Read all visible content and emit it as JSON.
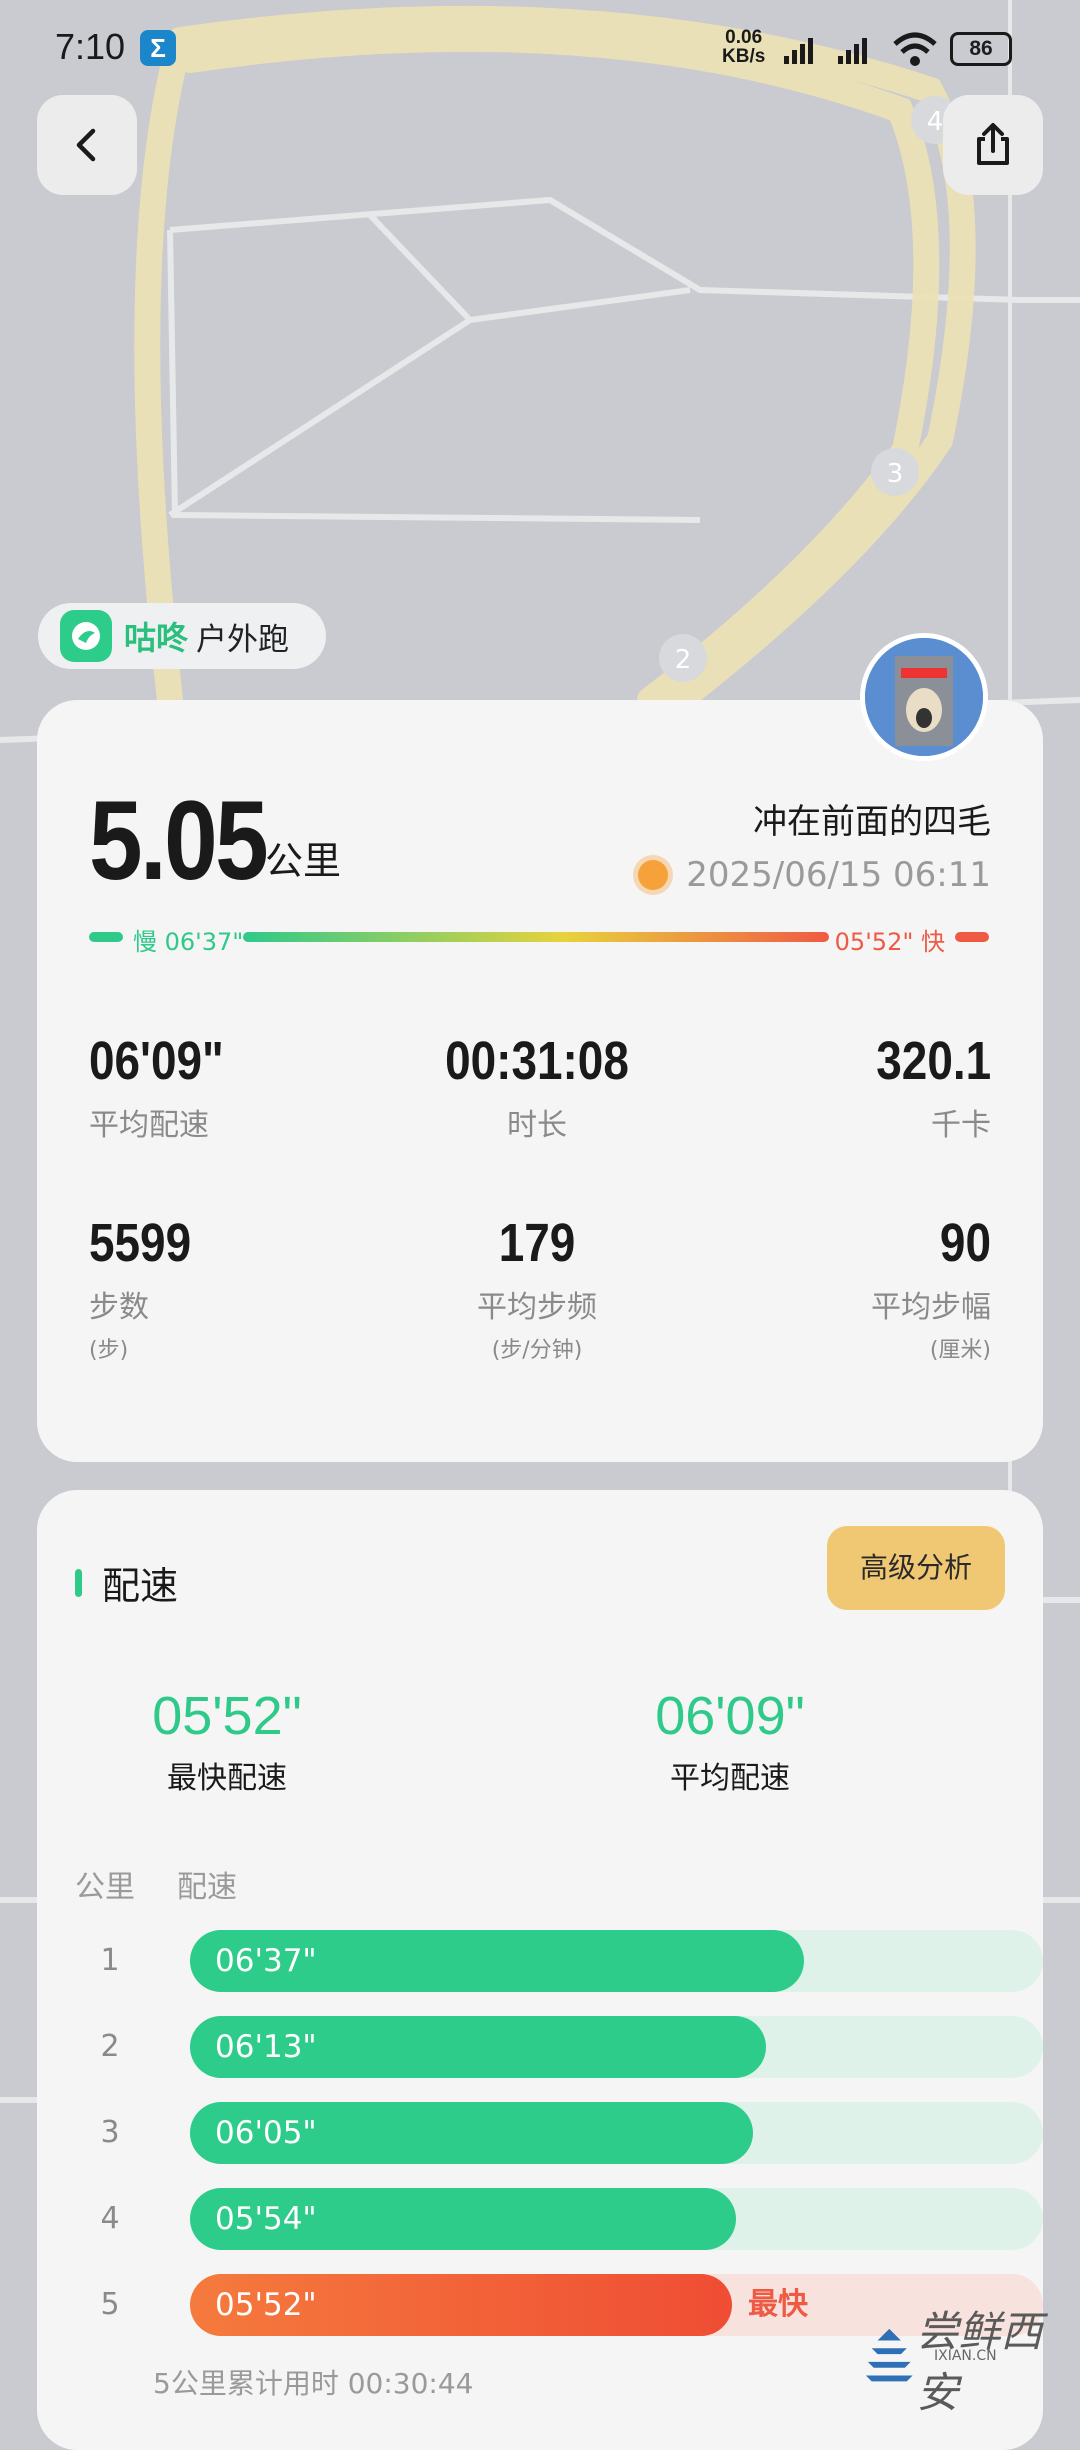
{
  "status_bar": {
    "time": "7:10",
    "app_icon": "Σ",
    "net_speed_value": "0.06",
    "net_speed_unit": "KB/s",
    "battery": "86"
  },
  "map": {
    "markers": [
      "4",
      "3",
      "2"
    ]
  },
  "brand": {
    "name": "咕咚",
    "activity_type": "户外跑"
  },
  "summary": {
    "distance": "5.05",
    "distance_unit": "公里",
    "runner_name": "冲在前面的四毛",
    "datetime": "2025/06/15 06:11",
    "slow_label": "慢 06'37\"",
    "fast_label": "05'52\" 快"
  },
  "stats": [
    {
      "value": "06'09\"",
      "label": "平均配速"
    },
    {
      "value": "00:31:08",
      "label": "时长"
    },
    {
      "value": "320.1",
      "label": "千卡"
    },
    {
      "value": "5599",
      "label": "步数",
      "unit": "(步)"
    },
    {
      "value": "179",
      "label": "平均步频",
      "unit": "(步/分钟)"
    },
    {
      "value": "90",
      "label": "平均步幅",
      "unit": "(厘米)"
    }
  ],
  "pace_section": {
    "title": "配速",
    "advanced_button": "高级分析",
    "fastest_value": "05'52\"",
    "fastest_label": "最快配速",
    "average_value": "06'09\"",
    "average_label": "平均配速",
    "col_km": "公里",
    "col_pace": "配速",
    "splits": [
      {
        "km": "1",
        "pace": "06'37\"",
        "fraction": 0.72
      },
      {
        "km": "2",
        "pace": "06'13\"",
        "fraction": 0.675
      },
      {
        "km": "3",
        "pace": "06'05\"",
        "fraction": 0.66
      },
      {
        "km": "4",
        "pace": "05'54\"",
        "fraction": 0.64
      },
      {
        "km": "5",
        "pace": "05'52\"",
        "fraction": 0.635,
        "tag": "最快"
      }
    ],
    "cumulative": "5公里累计用时 00:30:44"
  },
  "watermark": {
    "text": "尝鲜西安",
    "site": "IXIAN.CN"
  },
  "colors": {
    "accent_green": "#2ecc8a",
    "fast_red": "#ef5a45",
    "gold": "#f0c874"
  }
}
